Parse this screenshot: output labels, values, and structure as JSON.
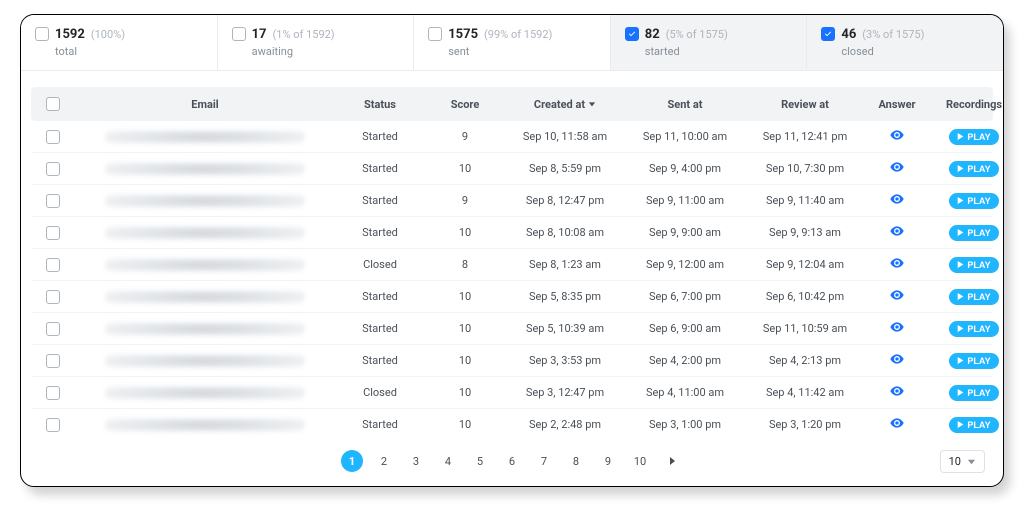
{
  "filters": [
    {
      "count": "1592",
      "pct": "(100%)",
      "label": "total",
      "checked": false,
      "active": false
    },
    {
      "count": "17",
      "pct": "(1% of 1592)",
      "label": "awaiting",
      "checked": false,
      "active": false
    },
    {
      "count": "1575",
      "pct": "(99% of 1592)",
      "label": "sent",
      "checked": false,
      "active": false
    },
    {
      "count": "82",
      "pct": "(5% of 1575)",
      "label": "started",
      "checked": true,
      "active": true
    },
    {
      "count": "46",
      "pct": "(3% of 1575)",
      "label": "closed",
      "checked": true,
      "active": true
    }
  ],
  "columns": {
    "email": "Email",
    "status": "Status",
    "score": "Score",
    "created": "Created at",
    "sent": "Sent at",
    "review": "Review at",
    "answer": "Answer",
    "recordings": "Recordings"
  },
  "play_label": "PLAY",
  "rows": [
    {
      "status": "Started",
      "score": "9",
      "created": "Sep 10, 11:58 am",
      "sent": "Sep 11, 10:00 am",
      "review": "Sep 11, 12:41 pm"
    },
    {
      "status": "Started",
      "score": "10",
      "created": "Sep 8, 5:59 pm",
      "sent": "Sep 9, 4:00 pm",
      "review": "Sep 10, 7:30 pm"
    },
    {
      "status": "Started",
      "score": "9",
      "created": "Sep 8, 12:47 pm",
      "sent": "Sep 9, 11:00 am",
      "review": "Sep 9, 11:40 am"
    },
    {
      "status": "Started",
      "score": "10",
      "created": "Sep 8, 10:08 am",
      "sent": "Sep 9, 9:00 am",
      "review": "Sep 9, 9:13 am"
    },
    {
      "status": "Closed",
      "score": "8",
      "created": "Sep 8, 1:23 am",
      "sent": "Sep 9, 12:00 am",
      "review": "Sep 9, 12:04 am"
    },
    {
      "status": "Started",
      "score": "10",
      "created": "Sep 5, 8:35 pm",
      "sent": "Sep 6, 7:00 pm",
      "review": "Sep 6, 10:42 pm"
    },
    {
      "status": "Started",
      "score": "10",
      "created": "Sep 5, 10:39 am",
      "sent": "Sep 6, 9:00 am",
      "review": "Sep 11, 10:59 am"
    },
    {
      "status": "Started",
      "score": "10",
      "created": "Sep 3, 3:53 pm",
      "sent": "Sep 4, 2:00 pm",
      "review": "Sep 4, 2:13 pm"
    },
    {
      "status": "Closed",
      "score": "10",
      "created": "Sep 3, 12:47 pm",
      "sent": "Sep 4, 11:00 am",
      "review": "Sep 4, 11:42 am"
    },
    {
      "status": "Started",
      "score": "10",
      "created": "Sep 2, 2:48 pm",
      "sent": "Sep 3, 1:00 pm",
      "review": "Sep 3, 1:20 pm"
    }
  ],
  "pagination": {
    "pages": [
      "1",
      "2",
      "3",
      "4",
      "5",
      "6",
      "7",
      "8",
      "9",
      "10"
    ],
    "active": "1",
    "page_size": "10"
  }
}
